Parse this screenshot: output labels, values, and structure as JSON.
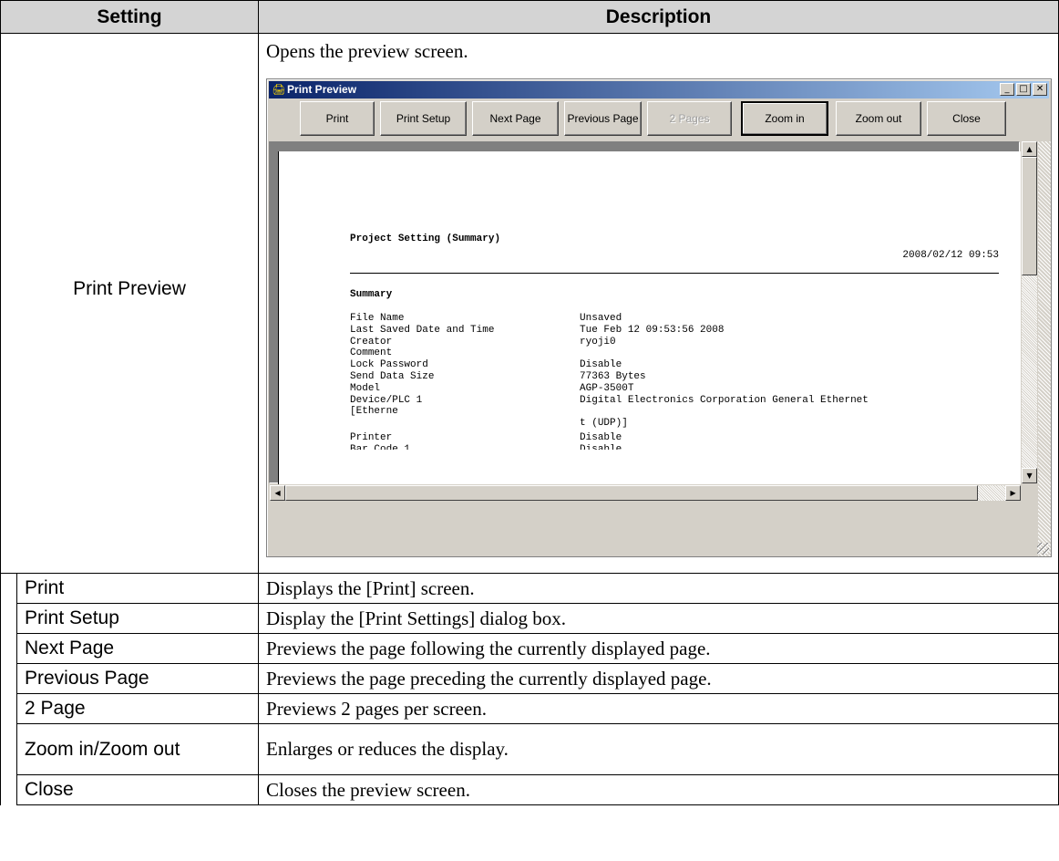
{
  "table": {
    "header": {
      "setting": "Setting",
      "description": "Description"
    },
    "main_setting": "Print Preview",
    "main_description": "Opens the preview screen.",
    "rows": [
      {
        "setting": "Print",
        "description": "Displays the [Print] screen."
      },
      {
        "setting": "Print Setup",
        "description": "Display the [Print Settings] dialog box."
      },
      {
        "setting": "Next Page",
        "description": "Previews the page following the currently displayed page."
      },
      {
        "setting": "Previous Page",
        "description": "Previews the page preceding the currently displayed page."
      },
      {
        "setting": "2 Page",
        "description": "Previews 2 pages per screen."
      },
      {
        "setting": "Zoom in/Zoom out",
        "description": "Enlarges or reduces the display."
      },
      {
        "setting": "Close",
        "description": "Closes the preview screen."
      }
    ]
  },
  "window": {
    "title": "Print Preview",
    "icon": "printer-icon",
    "title_buttons": {
      "minimize": "_",
      "maximize": "□",
      "close": "✕"
    },
    "toolbar": {
      "print": "Print",
      "print_setup": "Print Setup",
      "next_page": "Next Page",
      "previous_page": "Previous Page",
      "two_pages": "2 Pages",
      "zoom_in": "Zoom in",
      "zoom_out": "Zoom out",
      "close": "Close"
    },
    "page": {
      "title": "Project Setting (Summary)",
      "date": "2008/02/12 09:53",
      "section": "Summary",
      "rows": [
        {
          "label": "File Name",
          "value": "Unsaved"
        },
        {
          "label": "Last Saved Date and Time",
          "value": "Tue Feb 12 09:53:56 2008"
        },
        {
          "label": "Creator",
          "value": "ryoji0"
        },
        {
          "label": "Comment",
          "value": ""
        },
        {
          "label": "Lock Password",
          "value": "Disable"
        },
        {
          "label": "Send Data Size",
          "value": "77363 Bytes"
        },
        {
          "label": "Model",
          "value": "AGP-3500T"
        },
        {
          "label": "Device/PLC 1",
          "value": "Digital Electronics Corporation General Ethernet"
        },
        {
          "label": "[Etherne",
          "value": ""
        },
        {
          "label": "",
          "value": "t (UDP)]"
        },
        {
          "label": "Printer",
          "value": "Disable"
        },
        {
          "label": "Bar Code 1",
          "value": "Disable"
        }
      ]
    },
    "scroll_glyphs": {
      "up": "▲",
      "down": "▼",
      "left": "◀",
      "right": "▶"
    }
  }
}
